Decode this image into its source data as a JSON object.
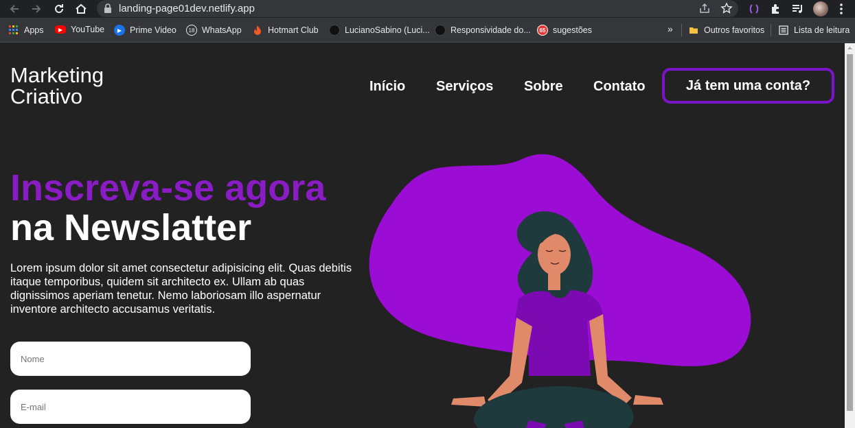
{
  "browser": {
    "url": "landing-page01dev.netlify.app",
    "bookmarks": [
      {
        "label": "Apps",
        "icon": "apps-grid-icon"
      },
      {
        "label": "YouTube",
        "icon": "youtube-icon"
      },
      {
        "label": "Prime Video",
        "icon": "prime-video-icon"
      },
      {
        "label": "WhatsApp",
        "icon": "whatsapp-icon"
      },
      {
        "label": "Hotmart Club",
        "icon": "hotmart-icon"
      },
      {
        "label": "LucianoSabino (Luci...",
        "icon": "github-icon"
      },
      {
        "label": "Responsividade do...",
        "icon": "github-icon"
      },
      {
        "label": "sugestões",
        "icon": "badge-icon"
      }
    ],
    "whatsapp_badge": "18",
    "sugestoes_badge": "65",
    "overflow": "»",
    "other_favorites": "Outros favoritos",
    "reading_list": "Lista de leitura"
  },
  "header": {
    "logo_line1": "Marketing",
    "logo_line2": "Criativo",
    "nav": [
      "Início",
      "Serviços",
      "Sobre",
      "Contato"
    ],
    "login_label": "Já tem uma conta?"
  },
  "hero": {
    "title_line1": "Inscreva-se agora",
    "title_line2": "na Newslatter",
    "description": "Lorem ipsum dolor sit amet consectetur adipisicing elit. Quas debitis itaque temporibus, quidem sit architecto ex. Ullam ab quas dignissimos aperiam tenetur. Nemo laboriosam illo aspernatur inventore architecto accusamus veritatis.",
    "name_placeholder": "Nome",
    "email_placeholder": "E-mail"
  },
  "colors": {
    "accent": "#8a1cc5",
    "blob": "#9b0cd4",
    "background": "#222222",
    "button_border": "#7a14c8"
  }
}
